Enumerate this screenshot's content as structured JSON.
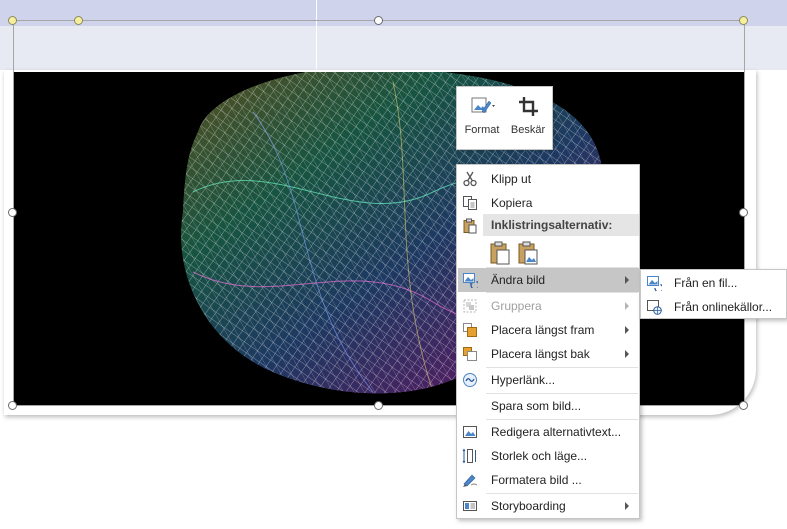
{
  "mini_toolbar": {
    "format_label": "Format",
    "crop_label": "Beskär"
  },
  "context_menu": {
    "cut": "Klipp ut",
    "copy": "Kopiera",
    "paste_options": "Inklistringsalternativ:",
    "change_picture": "Ändra bild",
    "group": "Gruppera",
    "bring_to_front": "Placera längst fram",
    "send_to_back": "Placera längst bak",
    "hyperlink": "Hyperlänk...",
    "save_as_picture": "Spara som bild...",
    "edit_alt_text": "Redigera alternativtext...",
    "size_and_position": "Storlek och läge...",
    "format_picture": "Formatera bild ...",
    "storyboarding": "Storyboarding"
  },
  "submenu": {
    "from_file": "Från en fil...",
    "from_online": "Från onlinekällor..."
  },
  "colors": {
    "highlight": "#c6c6c6",
    "top_band": "#cfd4ec",
    "rotation_handle": "#f6ef9e"
  }
}
